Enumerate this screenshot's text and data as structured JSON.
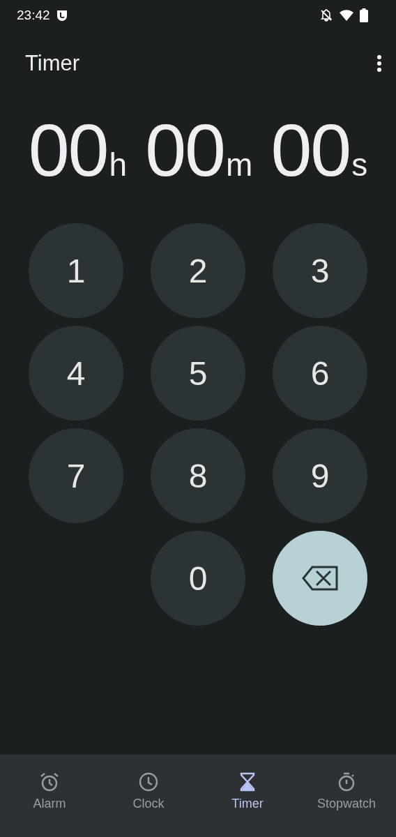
{
  "status_bar": {
    "time": "23:42"
  },
  "header": {
    "title": "Timer"
  },
  "display": [
    {
      "value": "00",
      "unit": "h"
    },
    {
      "value": "00",
      "unit": "m"
    },
    {
      "value": "00",
      "unit": "s"
    }
  ],
  "keypad": [
    {
      "kind": "digit",
      "label": "1"
    },
    {
      "kind": "digit",
      "label": "2"
    },
    {
      "kind": "digit",
      "label": "3"
    },
    {
      "kind": "digit",
      "label": "4"
    },
    {
      "kind": "digit",
      "label": "5"
    },
    {
      "kind": "digit",
      "label": "6"
    },
    {
      "kind": "digit",
      "label": "7"
    },
    {
      "kind": "digit",
      "label": "8"
    },
    {
      "kind": "digit",
      "label": "9"
    },
    {
      "kind": "spacer"
    },
    {
      "kind": "digit",
      "label": "0"
    },
    {
      "kind": "backspace"
    }
  ],
  "nav": [
    {
      "label": "Alarm",
      "selected": false
    },
    {
      "label": "Clock",
      "selected": false
    },
    {
      "label": "Timer",
      "selected": true
    },
    {
      "label": "Stopwatch",
      "selected": false
    }
  ]
}
